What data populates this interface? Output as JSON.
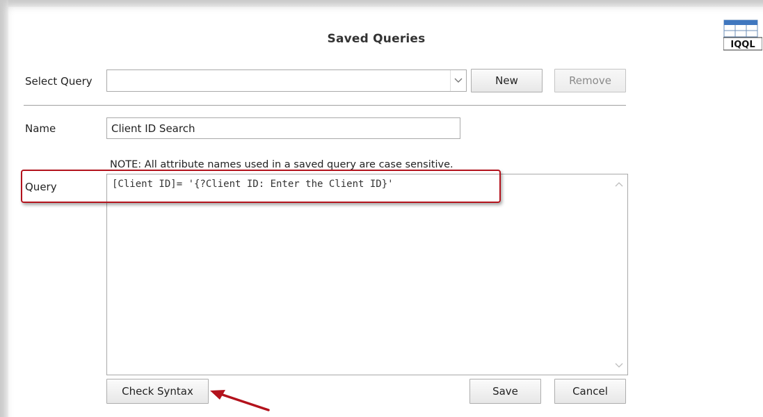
{
  "dialog": {
    "title": "Saved Queries",
    "icon_label": "IQQL"
  },
  "select_query": {
    "label": "Select Query",
    "value": "",
    "new_label": "New",
    "remove_label": "Remove"
  },
  "name": {
    "label": "Name",
    "value": "Client ID Search"
  },
  "note": "NOTE:  All attribute names used in a saved query are case sensitive.",
  "query": {
    "label": "Query",
    "value": "[Client ID]= '{?Client ID: Enter the Client ID}'"
  },
  "buttons": {
    "check_syntax": "Check Syntax",
    "save": "Save",
    "cancel": "Cancel"
  },
  "colors": {
    "annotation_red": "#b3121c"
  }
}
